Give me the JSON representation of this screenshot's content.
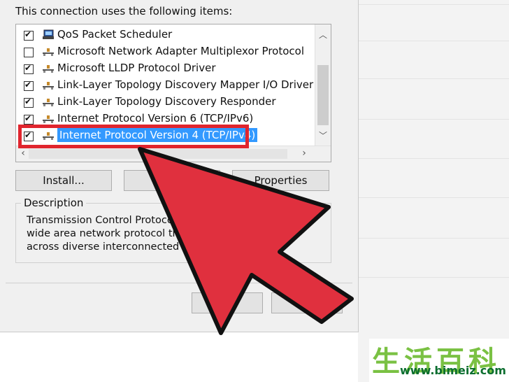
{
  "header": {
    "text": "This connection uses the following items:"
  },
  "items": [
    {
      "label": "QoS Packet Scheduler",
      "checked": true,
      "icon": "network-scheduler-icon",
      "selected": false
    },
    {
      "label": "Microsoft Network Adapter Multiplexor Protocol",
      "checked": false,
      "icon": "network-protocol-icon",
      "selected": false
    },
    {
      "label": "Microsoft LLDP Protocol Driver",
      "checked": true,
      "icon": "network-protocol-icon",
      "selected": false
    },
    {
      "label": "Link-Layer Topology Discovery Mapper I/O Driver",
      "checked": true,
      "icon": "network-protocol-icon",
      "selected": false
    },
    {
      "label": "Link-Layer Topology Discovery Responder",
      "checked": true,
      "icon": "network-protocol-icon",
      "selected": false
    },
    {
      "label": "Internet Protocol Version 6 (TCP/IPv6)",
      "checked": true,
      "icon": "network-protocol-icon",
      "selected": false
    },
    {
      "label": "Internet Protocol Version 4 (TCP/IPv4)",
      "checked": true,
      "icon": "network-protocol-icon",
      "selected": true
    }
  ],
  "buttons": {
    "install": "Install...",
    "uninstall": "",
    "properties": "Properties",
    "ok": "",
    "cancel": ""
  },
  "description": {
    "title": "Description",
    "lines": [
      "Transmission Control Protocol/",
      "wide area network protocol that",
      "across diverse interconnected ne"
    ]
  },
  "watermark": {
    "chars": "生活百科",
    "url": "www.bimeiz.com"
  },
  "colors": {
    "highlight": "#e0252e",
    "arrow": "#e0303e",
    "selection": "#3399ff"
  }
}
